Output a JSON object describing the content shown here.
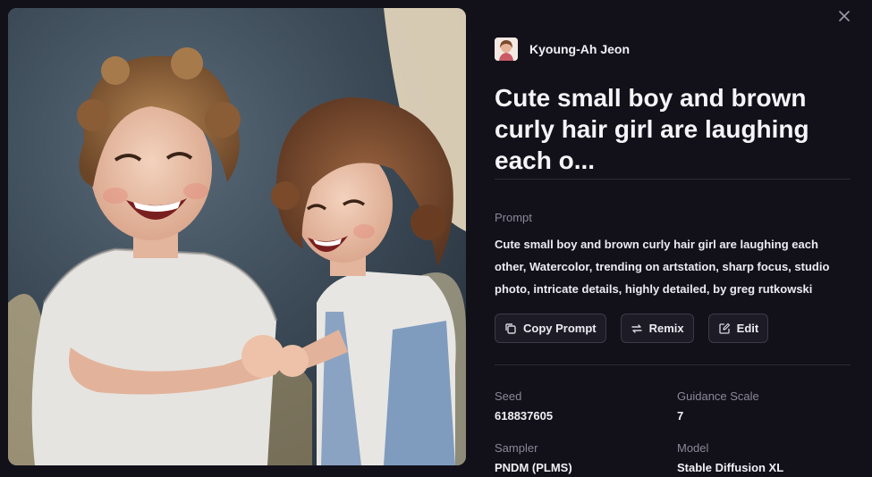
{
  "author": {
    "name": "Kyoung-Ah Jeon"
  },
  "title": "Cute small boy and brown curly hair girl are laughing each o...",
  "prompt": {
    "label": "Prompt",
    "text": "Cute small boy and brown curly hair girl are laughing each other, Watercolor, trending on artstation, sharp focus, studio photo, intricate details, highly detailed, by greg rutkowski"
  },
  "actions": {
    "copy_prompt": "Copy Prompt",
    "remix": "Remix",
    "edit": "Edit"
  },
  "meta": {
    "seed_label": "Seed",
    "seed_value": "618837605",
    "guidance_label": "Guidance Scale",
    "guidance_value": "7",
    "sampler_label": "Sampler",
    "sampler_value": "PNDM (PLMS)",
    "model_label": "Model",
    "model_value": "Stable Diffusion XL"
  },
  "icons": {
    "close": "close-icon",
    "copy": "copy-icon",
    "remix": "remix-icon",
    "edit": "edit-icon"
  },
  "colors": {
    "background": "#12111a",
    "button_bg": "#1d1c26",
    "muted_text": "#8a8896"
  }
}
